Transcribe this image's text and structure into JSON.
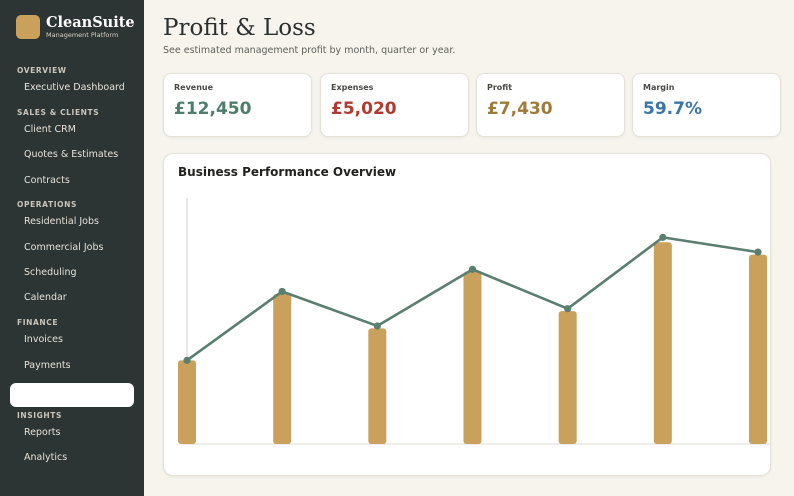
{
  "brand": {
    "name": "CleanSuite",
    "subtitle": "Management Platform"
  },
  "sidebar": {
    "sections": [
      {
        "label": "OVERVIEW",
        "items": [
          "Executive Dashboard"
        ]
      },
      {
        "label": "SALES & CLIENTS",
        "items": [
          "Client CRM",
          "Quotes & Estimates",
          "Contracts"
        ]
      },
      {
        "label": "OPERATIONS",
        "items": [
          "Residential Jobs",
          "Commercial Jobs",
          "Scheduling",
          "Calendar"
        ]
      },
      {
        "label": "FINANCE",
        "items": [
          "Invoices",
          "Payments"
        ]
      },
      {
        "label": "INSIGHTS",
        "items": [
          "Reports",
          "Analytics"
        ]
      }
    ]
  },
  "page": {
    "title": "Profit & Loss",
    "subtitle": "See estimated management profit by month, quarter or year."
  },
  "kpis": [
    {
      "label": "Revenue",
      "value": "£12,450",
      "color": "#4e7d6c"
    },
    {
      "label": "Expenses",
      "value": "£5,020",
      "color": "#b03a2e"
    },
    {
      "label": "Profit",
      "value": "£7,430",
      "color": "#a07a3a"
    },
    {
      "label": "Margin",
      "value": "59.7%",
      "color": "#3b76a8"
    }
  ],
  "chart_data": {
    "type": "bar",
    "title": "Business Performance Overview",
    "bar_values": [
      34,
      61,
      47,
      70,
      54,
      82,
      77
    ],
    "line_values": [
      34,
      62,
      48,
      71,
      55,
      84,
      78
    ],
    "ylim": [
      0,
      100
    ],
    "bar_color": "#c9a15c",
    "line_color": "#5a7e6f",
    "grid": false
  }
}
